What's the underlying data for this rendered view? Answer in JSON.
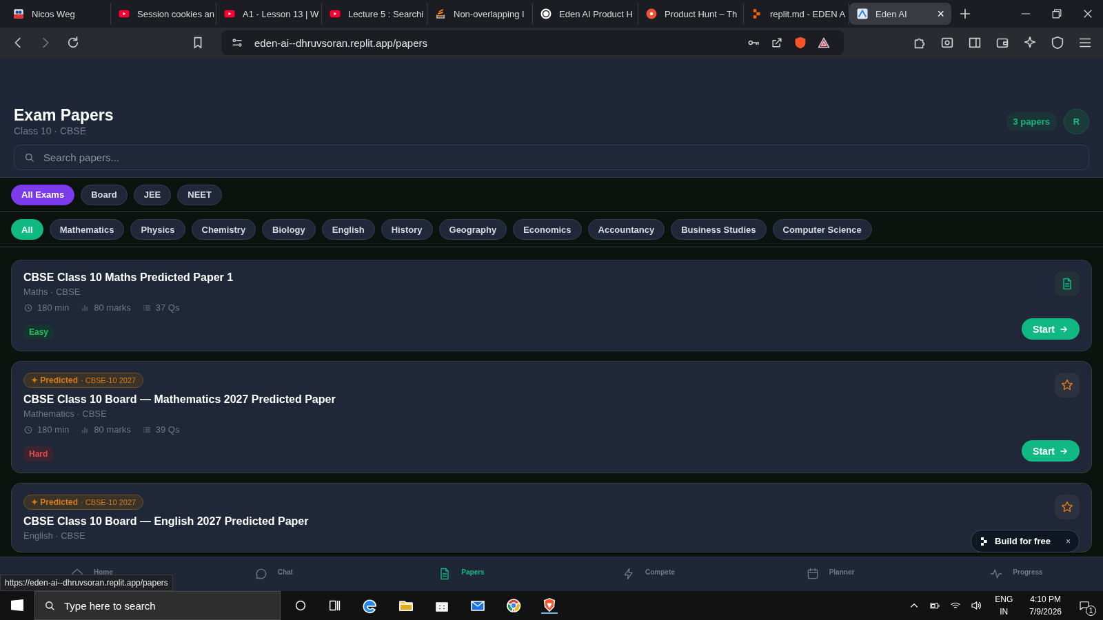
{
  "browser": {
    "tabs": [
      {
        "title": "Nicos Weg",
        "kind": "square",
        "selected": false
      },
      {
        "title": "Session cookies an",
        "kind": "video",
        "selected": false
      },
      {
        "title": "A1 - Lesson 13 | W",
        "kind": "video",
        "selected": false
      },
      {
        "title": "Lecture 5 : Searchi",
        "kind": "video",
        "selected": false
      },
      {
        "title": "Non-overlapping I",
        "kind": "stack",
        "selected": false
      },
      {
        "title": "Eden AI Product H",
        "kind": "knot",
        "selected": false
      },
      {
        "title": "Product Hunt – Th",
        "kind": "dot",
        "selected": false
      },
      {
        "title": "replit.md - EDEN A",
        "kind": "replit",
        "selected": false
      },
      {
        "title": "Eden AI",
        "kind": "peak",
        "selected": true
      }
    ],
    "close_tab": "×",
    "url": "eden-ai--dhruvsoran.replit.app/papers",
    "status_url": "https://eden-ai--dhruvsoran.replit.app/papers"
  },
  "page": {
    "title": "Exam Papers",
    "subtitle": "Class 10 · CBSE",
    "count_badge": "3 papers",
    "avatar": "R",
    "search": {
      "placeholder": "Search papers..."
    },
    "exam_filters": [
      {
        "label": "All Exams",
        "selected": true
      },
      {
        "label": "Board",
        "selected": false
      },
      {
        "label": "JEE",
        "selected": false
      },
      {
        "label": "NEET",
        "selected": false
      }
    ],
    "subject_filters": [
      {
        "label": "All",
        "selected": true
      },
      {
        "label": "Mathematics",
        "selected": false
      },
      {
        "label": "Physics",
        "selected": false
      },
      {
        "label": "Chemistry",
        "selected": false
      },
      {
        "label": "Biology",
        "selected": false
      },
      {
        "label": "English",
        "selected": false
      },
      {
        "label": "History",
        "selected": false
      },
      {
        "label": "Geography",
        "selected": false
      },
      {
        "label": "Economics",
        "selected": false
      },
      {
        "label": "Accountancy",
        "selected": false
      },
      {
        "label": "Business Studies",
        "selected": false
      },
      {
        "label": "Computer Science",
        "selected": false
      }
    ],
    "papers": [
      {
        "title": "CBSE Class 10 Maths Predicted Paper 1",
        "meta": "Maths · CBSE",
        "duration": "180 min",
        "marks": "80 marks",
        "questions": "37 Qs",
        "difficulty": {
          "label": "Easy",
          "kind": "easy"
        },
        "kind": "document",
        "button": "Start"
      },
      {
        "badge": {
          "label": "✦ Predicted",
          "code": "· CBSE-10 2027"
        },
        "title": "CBSE Class 10 Board — Mathematics 2027 Predicted Paper",
        "meta": "Mathematics · CBSE",
        "duration": "180 min",
        "marks": "80 marks",
        "questions": "39 Qs",
        "difficulty": {
          "label": "Hard",
          "kind": "hard"
        },
        "kind": "star",
        "button": "Start"
      },
      {
        "badge": {
          "label": "✦ Predicted",
          "code": "· CBSE-10 2027"
        },
        "title": "CBSE Class 10 Board — English 2027 Predicted Paper",
        "meta": "English · CBSE",
        "kind": "star"
      }
    ]
  },
  "bottom_nav": [
    {
      "label": "Home",
      "kind": "home",
      "selected": false
    },
    {
      "label": "Chat",
      "kind": "chat",
      "selected": false
    },
    {
      "label": "Papers",
      "kind": "document",
      "selected": true
    },
    {
      "label": "Compete",
      "kind": "bolt",
      "selected": false
    },
    {
      "label": "Planner",
      "kind": "calendar",
      "selected": false
    },
    {
      "label": "Progress",
      "kind": "pulse",
      "selected": false
    }
  ],
  "replit_badge": {
    "label": "Build for free",
    "close": "×"
  },
  "taskbar": {
    "search_placeholder": "Type here to search",
    "language": "ENG",
    "region": "IN",
    "time": "4:10 PM",
    "date": "7/9/2026",
    "notifications": "1"
  }
}
